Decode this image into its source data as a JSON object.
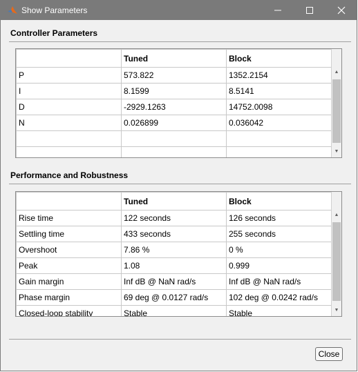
{
  "window": {
    "title": "Show  Parameters"
  },
  "controller": {
    "heading": "Controller Parameters",
    "columns": [
      "",
      "Tuned",
      "Block"
    ],
    "rows": [
      [
        "P",
        "573.822",
        "1352.2154"
      ],
      [
        "I",
        "8.1599",
        "8.5141"
      ],
      [
        "D",
        "-2929.1263",
        "14752.0098"
      ],
      [
        "N",
        "0.026899",
        "0.036042"
      ],
      [
        "",
        "",
        ""
      ],
      [
        "",
        "",
        ""
      ]
    ]
  },
  "performance": {
    "heading": "Performance and Robustness",
    "columns": [
      "",
      "Tuned",
      "Block"
    ],
    "rows": [
      [
        "Rise time",
        "122 seconds",
        "126 seconds"
      ],
      [
        "Settling time",
        "433 seconds",
        "255 seconds"
      ],
      [
        "Overshoot",
        "7.86 %",
        "0 %"
      ],
      [
        "Peak",
        "1.08",
        "0.999"
      ],
      [
        "Gain margin",
        "Inf dB @ NaN rad/s",
        "Inf dB @ NaN rad/s"
      ],
      [
        "Phase margin",
        "69 deg @ 0.0127 rad/s",
        "102 deg @ 0.0242 rad/s"
      ],
      [
        "Closed-loop stability",
        "Stable",
        "Stable"
      ]
    ]
  },
  "footer": {
    "close_label": "Close"
  },
  "icons": {
    "app": "matlab-icon",
    "minimize": "minimize-icon",
    "maximize": "maximize-icon",
    "close": "close-icon"
  },
  "colors": {
    "titlebar": "#7a7a7a",
    "window_bg": "#f0f0f0",
    "grid": "#c8c8c8"
  }
}
